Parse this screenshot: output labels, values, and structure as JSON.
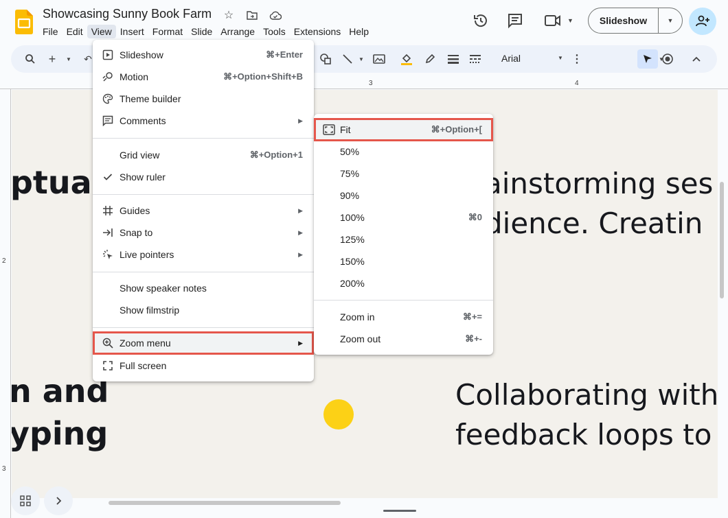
{
  "app": {
    "doc_title": "Showcasing Sunny Book Farm",
    "menubar": [
      "File",
      "Edit",
      "View",
      "Insert",
      "Format",
      "Slide",
      "Arrange",
      "Tools",
      "Extensions",
      "Help"
    ],
    "slideshow_label": "Slideshow",
    "font_name": "Arial"
  },
  "ruler": {
    "h_marks": [
      "3",
      "4"
    ],
    "v_marks": [
      "2",
      "3"
    ]
  },
  "slide": {
    "text_left_1": "ptua",
    "text_left_2": "n and",
    "text_left_3": "yping",
    "text_right_1": "ainstorming ses",
    "text_right_2": "dience. Creatin",
    "text_right_3": "Collaborating with",
    "text_right_4": "feedback loops to",
    "dot_color": "#fcd116"
  },
  "view_menu": {
    "slideshow": {
      "label": "Slideshow",
      "shortcut": "⌘+Enter"
    },
    "motion": {
      "label": "Motion",
      "shortcut": "⌘+Option+Shift+B"
    },
    "theme_builder": {
      "label": "Theme builder"
    },
    "comments": {
      "label": "Comments"
    },
    "grid_view": {
      "label": "Grid view",
      "shortcut": "⌘+Option+1"
    },
    "show_ruler": {
      "label": "Show ruler"
    },
    "guides": {
      "label": "Guides"
    },
    "snap_to": {
      "label": "Snap to"
    },
    "live_pointers": {
      "label": "Live pointers"
    },
    "speaker_notes": {
      "label": "Show speaker notes"
    },
    "filmstrip": {
      "label": "Show filmstrip"
    },
    "zoom_menu": {
      "label": "Zoom menu"
    },
    "full_screen": {
      "label": "Full screen"
    }
  },
  "zoom_menu": {
    "fit": {
      "label": "Fit",
      "shortcut": "⌘+Option+["
    },
    "levels": [
      {
        "label": "50%",
        "shortcut": ""
      },
      {
        "label": "75%",
        "shortcut": ""
      },
      {
        "label": "90%",
        "shortcut": ""
      },
      {
        "label": "100%",
        "shortcut": "⌘0"
      },
      {
        "label": "125%",
        "shortcut": ""
      },
      {
        "label": "150%",
        "shortcut": ""
      },
      {
        "label": "200%",
        "shortcut": ""
      }
    ],
    "zoom_in": {
      "label": "Zoom in",
      "shortcut": "⌘+="
    },
    "zoom_out": {
      "label": "Zoom out",
      "shortcut": "⌘+-"
    }
  },
  "colors": {
    "highlight": "#e5564b",
    "brand_yellow": "#fbbc04",
    "accent_blue": "#c2e7ff"
  }
}
